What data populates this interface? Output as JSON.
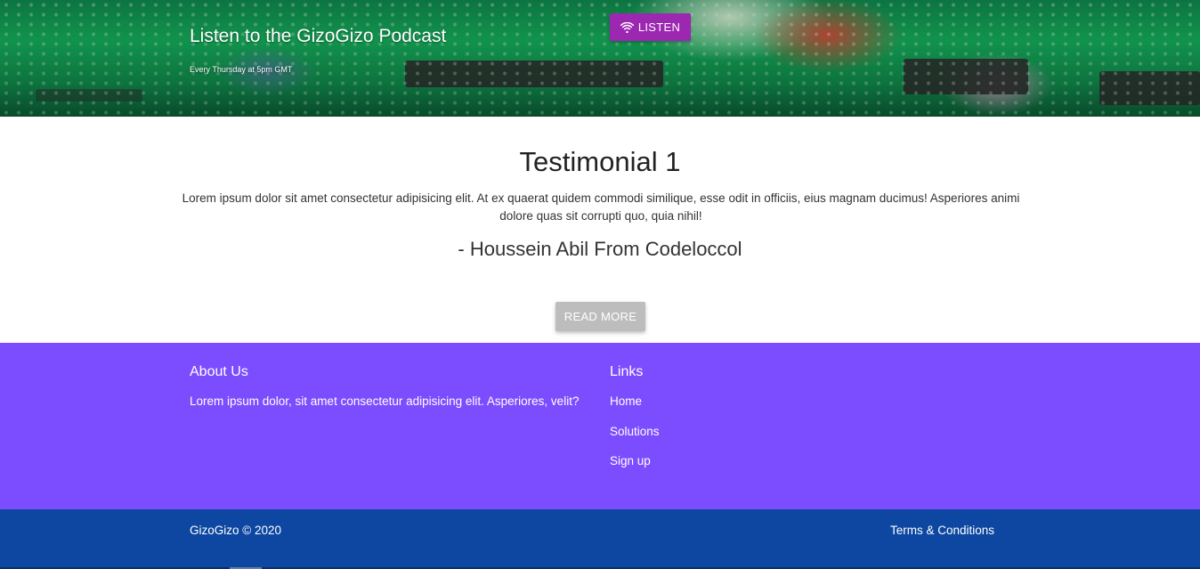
{
  "banner": {
    "title": "Listen to the GizoGizo Podcast",
    "subtitle": "Every Thursday at 5pm GMT",
    "listen_label": "LISTEN",
    "listen_icon": "wifi-icon",
    "listen_color": "#9c27b0"
  },
  "testimonial": {
    "title": "Testimonial 1",
    "body": "Lorem ipsum dolor sit amet consectetur adipisicing elit. At ex quaerat quidem commodi similique, esse odit in officiis, eius magnam ducimus! Asperiores animi dolore quas sit corrupti quo, quia nihil!",
    "author": "- Houssein Abil From Codeloccol",
    "read_more_label": "READ MORE"
  },
  "footer": {
    "background": "#7c4dff",
    "about": {
      "heading": "About Us",
      "text": "Lorem ipsum dolor, sit amet consectetur adipisicing elit. Asperiores, velit?"
    },
    "links": {
      "heading": "Links",
      "items": [
        {
          "label": "Home"
        },
        {
          "label": "Solutions"
        },
        {
          "label": "Sign up"
        }
      ]
    }
  },
  "bottom_bar": {
    "background": "#0d47a1",
    "copyright": "GizoGizo © 2020",
    "terms": "Terms & Conditions"
  }
}
